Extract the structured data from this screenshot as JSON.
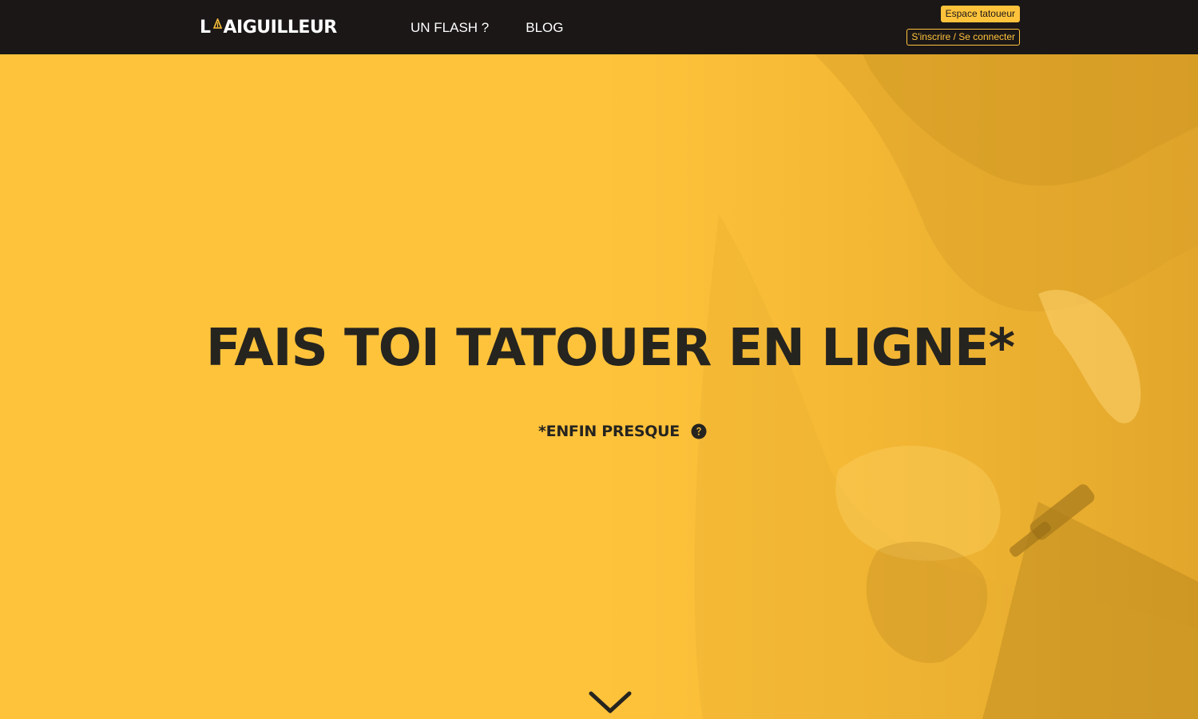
{
  "header": {
    "logo_first": "L",
    "logo_rest": "AIGUILLEUR",
    "nav": [
      {
        "label": "UN FLASH ?"
      },
      {
        "label": "BLOG"
      }
    ],
    "espace_label": "Espace tatoueur",
    "login_label": "S'inscrire / Se connecter"
  },
  "hero": {
    "title": "FAIS TOI TATOUER EN LIGNE*",
    "subtitle": "*ENFIN PRESQUE",
    "help_icon": "question-circle-icon",
    "scroll_icon": "chevron-down-icon"
  },
  "colors": {
    "header_bg": "#1b1717",
    "accent_yellow": "#ffc33b",
    "text_dark": "#26241f",
    "white": "#ffffff"
  }
}
